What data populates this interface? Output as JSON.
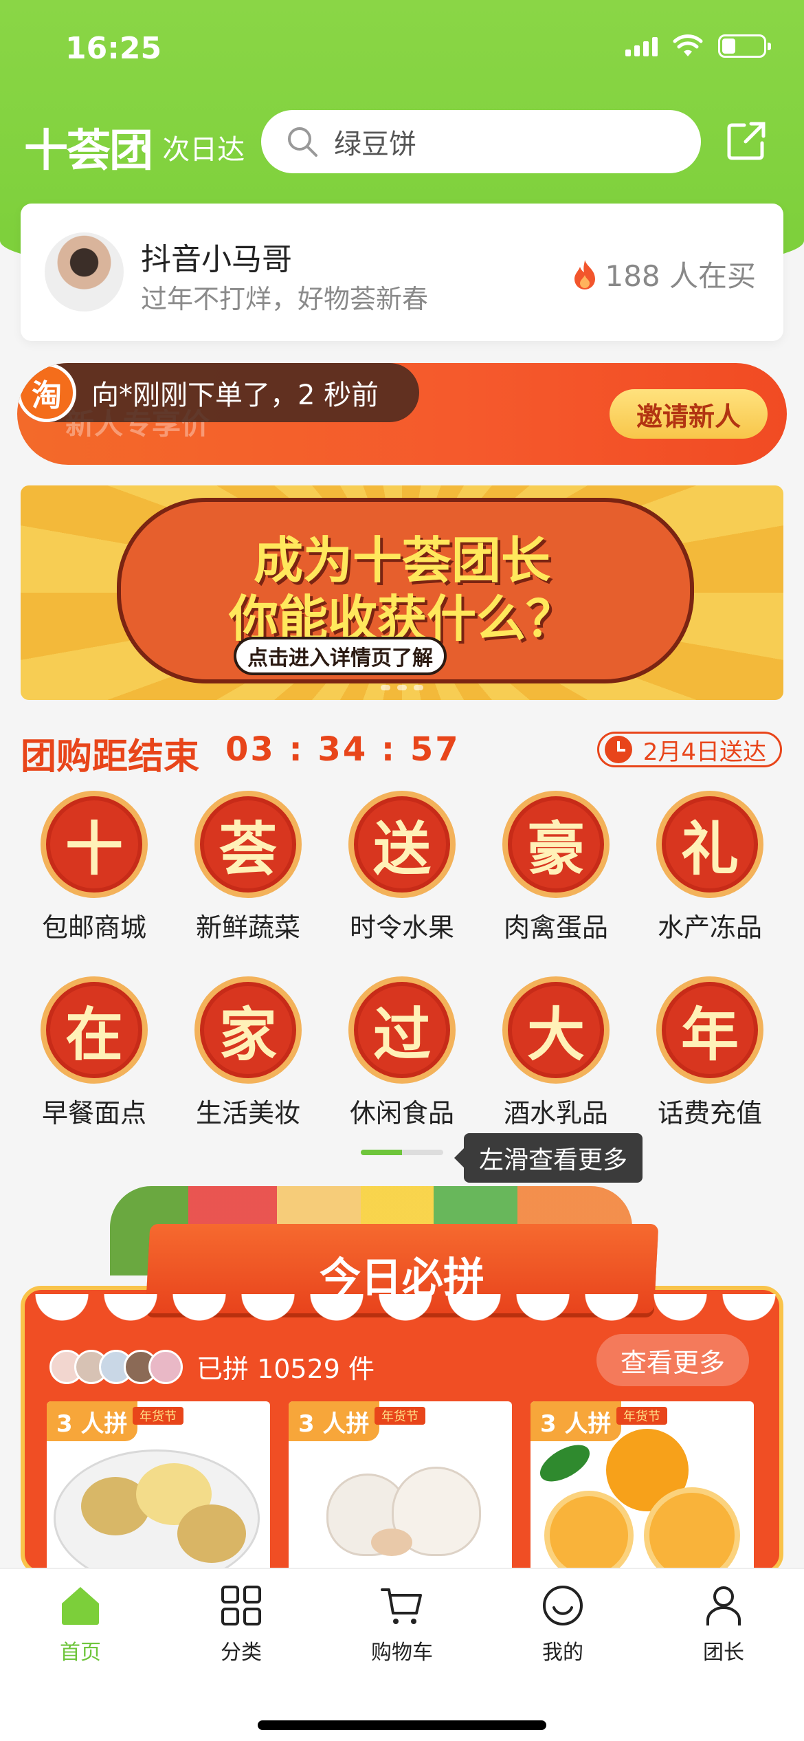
{
  "status_bar": {
    "time": "16:25"
  },
  "header": {
    "logo": "十荟团",
    "logo_sub": "• 次日达",
    "search_placeholder": "绿豆饼"
  },
  "leader": {
    "name": "抖音小马哥",
    "slogan": "过年不打烊，好物荟新春",
    "buyers": "188 人在买"
  },
  "promo": {
    "ticker_badge": "淘",
    "ticker_text": "向*刚刚下单了，2 秒前",
    "faint_text": "新人专享价",
    "invite_label": "邀请新人"
  },
  "banner": {
    "line1": "成为十荟团长",
    "line2": "你能收获什么？",
    "pill": "点击进入详情页了解"
  },
  "countdown": {
    "title": "团购距结束",
    "time": "03 : 34 : 57",
    "delivery": "2月4日送达"
  },
  "categories": [
    {
      "glyph": "十",
      "label": "包邮商城"
    },
    {
      "glyph": "荟",
      "label": "新鲜蔬菜"
    },
    {
      "glyph": "送",
      "label": "时令水果"
    },
    {
      "glyph": "豪",
      "label": "肉禽蛋品"
    },
    {
      "glyph": "礼",
      "label": "水产冻品"
    },
    {
      "glyph": "在",
      "label": "早餐面点"
    },
    {
      "glyph": "家",
      "label": "生活美妆"
    },
    {
      "glyph": "过",
      "label": "休闲食品"
    },
    {
      "glyph": "大",
      "label": "酒水乳品"
    },
    {
      "glyph": "年",
      "label": "话费充值"
    }
  ],
  "scroll_progress": 0.5,
  "tooltip": "左滑查看更多",
  "today": {
    "title": "今日必拼",
    "joined": "已拼 10529 件",
    "more_label": "查看更多",
    "products": [
      {
        "tag": "3 人拼",
        "badge": "年货节",
        "item": "potato"
      },
      {
        "tag": "3 人拼",
        "badge": "年货节",
        "item": "garlic"
      },
      {
        "tag": "3 人拼",
        "badge": "年货节",
        "item": "orange"
      }
    ]
  },
  "tabs": [
    {
      "label": "首页",
      "icon": "home-icon",
      "active": true
    },
    {
      "label": "分类",
      "icon": "grid-icon",
      "active": false
    },
    {
      "label": "购物车",
      "icon": "cart-icon",
      "active": false
    },
    {
      "label": "我的",
      "icon": "smile-icon",
      "active": false
    },
    {
      "label": "团长",
      "icon": "person-icon",
      "active": false
    }
  ],
  "colors": {
    "brand_green": "#7ccf3a",
    "accent_red": "#e8451a",
    "promo_orange": "#f36a2a"
  }
}
